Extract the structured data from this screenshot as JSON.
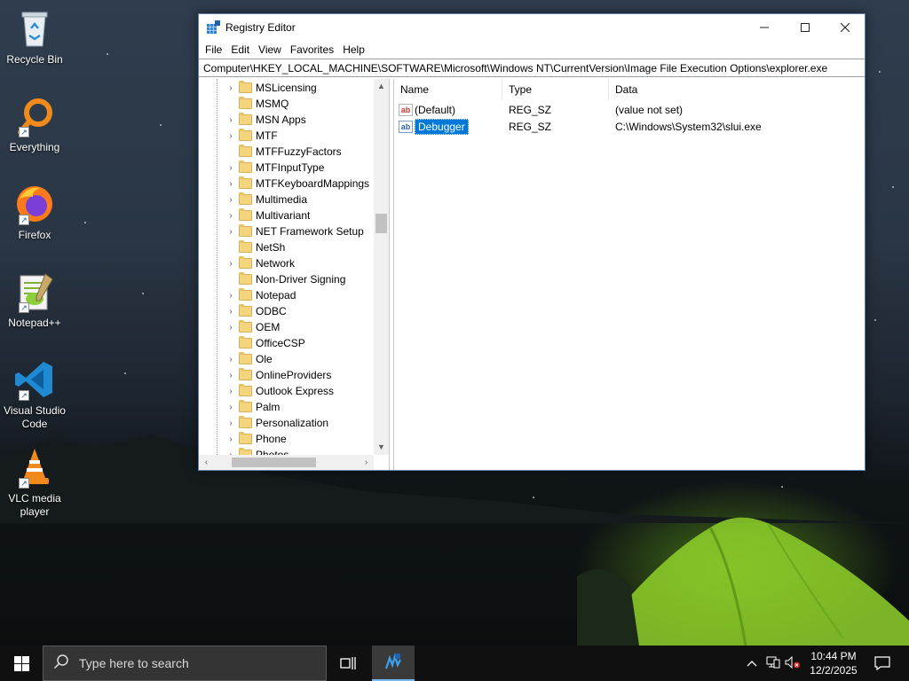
{
  "desktop": {
    "icons": [
      {
        "label": "Recycle Bin"
      },
      {
        "label": "Everything"
      },
      {
        "label": "Firefox"
      },
      {
        "label": "Notepad++"
      },
      {
        "label": "Visual Studio Code"
      },
      {
        "label": "VLC media player"
      }
    ]
  },
  "window": {
    "title": "Registry Editor",
    "menu": [
      "File",
      "Edit",
      "View",
      "Favorites",
      "Help"
    ],
    "address": "Computer\\HKEY_LOCAL_MACHINE\\SOFTWARE\\Microsoft\\Windows NT\\CurrentVersion\\Image File Execution Options\\explorer.exe",
    "tree_items": [
      {
        "label": "MSLicensing",
        "expandable": true
      },
      {
        "label": "MSMQ",
        "expandable": false
      },
      {
        "label": "MSN Apps",
        "expandable": true
      },
      {
        "label": "MTF",
        "expandable": true
      },
      {
        "label": "MTFFuzzyFactors",
        "expandable": false
      },
      {
        "label": "MTFInputType",
        "expandable": true
      },
      {
        "label": "MTFKeyboardMappings",
        "expandable": true
      },
      {
        "label": "Multimedia",
        "expandable": true
      },
      {
        "label": "Multivariant",
        "expandable": true
      },
      {
        "label": "NET Framework Setup",
        "expandable": true
      },
      {
        "label": "NetSh",
        "expandable": false
      },
      {
        "label": "Network",
        "expandable": true
      },
      {
        "label": "Non-Driver Signing",
        "expandable": false
      },
      {
        "label": "Notepad",
        "expandable": true
      },
      {
        "label": "ODBC",
        "expandable": true
      },
      {
        "label": "OEM",
        "expandable": true
      },
      {
        "label": "OfficeCSP",
        "expandable": false
      },
      {
        "label": "Ole",
        "expandable": true
      },
      {
        "label": "OnlineProviders",
        "expandable": true
      },
      {
        "label": "Outlook Express",
        "expandable": true
      },
      {
        "label": "Palm",
        "expandable": true
      },
      {
        "label": "Personalization",
        "expandable": true
      },
      {
        "label": "Phone",
        "expandable": true
      },
      {
        "label": "Photos",
        "expandable": true
      }
    ],
    "columns": {
      "name": "Name",
      "type": "Type",
      "data": "Data"
    },
    "values": [
      {
        "name": "(Default)",
        "type": "REG_SZ",
        "data": "(value not set)",
        "selected": false
      },
      {
        "name": "Debugger",
        "type": "REG_SZ",
        "data": "C:\\Windows\\System32\\slui.exe",
        "selected": true
      }
    ]
  },
  "taskbar": {
    "search_placeholder": "Type here to search",
    "time": "10:44 PM",
    "date": "12/2/2025"
  }
}
